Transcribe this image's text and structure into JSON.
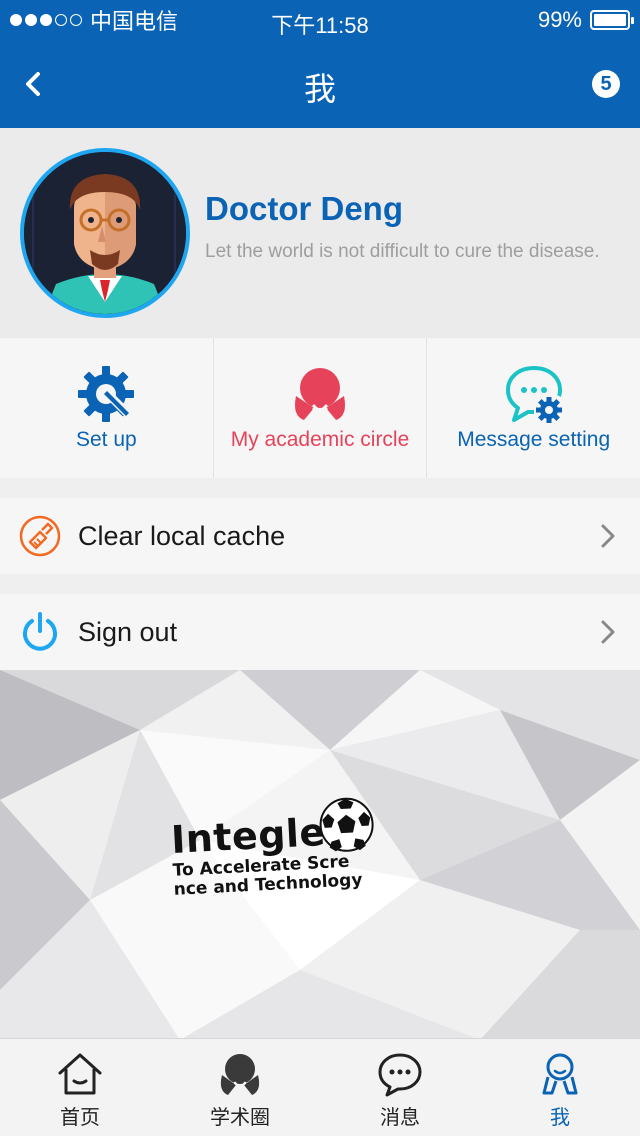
{
  "status_bar": {
    "carrier": "中国电信",
    "time": "下午11:58",
    "battery": "99%",
    "signal_strength": 3
  },
  "nav": {
    "title": "我",
    "badge_count": "5"
  },
  "profile": {
    "name": "Doctor Deng",
    "motto": "Let the world is not difficult to cure the disease."
  },
  "shortcuts": [
    {
      "label": "Set up",
      "color": "#0a63b4",
      "icon": "gear-wrench-icon"
    },
    {
      "label": "My academic circle",
      "color": "#e6435a",
      "icon": "academic-circle-icon"
    },
    {
      "label": "Message setting",
      "color": "#0a63b4",
      "icon": "chat-gear-icon"
    }
  ],
  "menu": {
    "clear_cache": "Clear local cache",
    "sign_out": "Sign out"
  },
  "banner": {
    "logo_text": "Integle",
    "slogan": "To Accelerate Scre nce and Technology"
  },
  "tabs": [
    {
      "label": "首页",
      "icon": "home-icon"
    },
    {
      "label": "学术圈",
      "icon": "academic-circle-icon"
    },
    {
      "label": "消息",
      "icon": "chat-icon"
    },
    {
      "label": "我",
      "icon": "person-icon"
    }
  ],
  "colors": {
    "primary": "#0a63b4",
    "accent_red": "#e6435a",
    "accent_orange": "#f26a22",
    "accent_cyan": "#1ea6f0"
  }
}
